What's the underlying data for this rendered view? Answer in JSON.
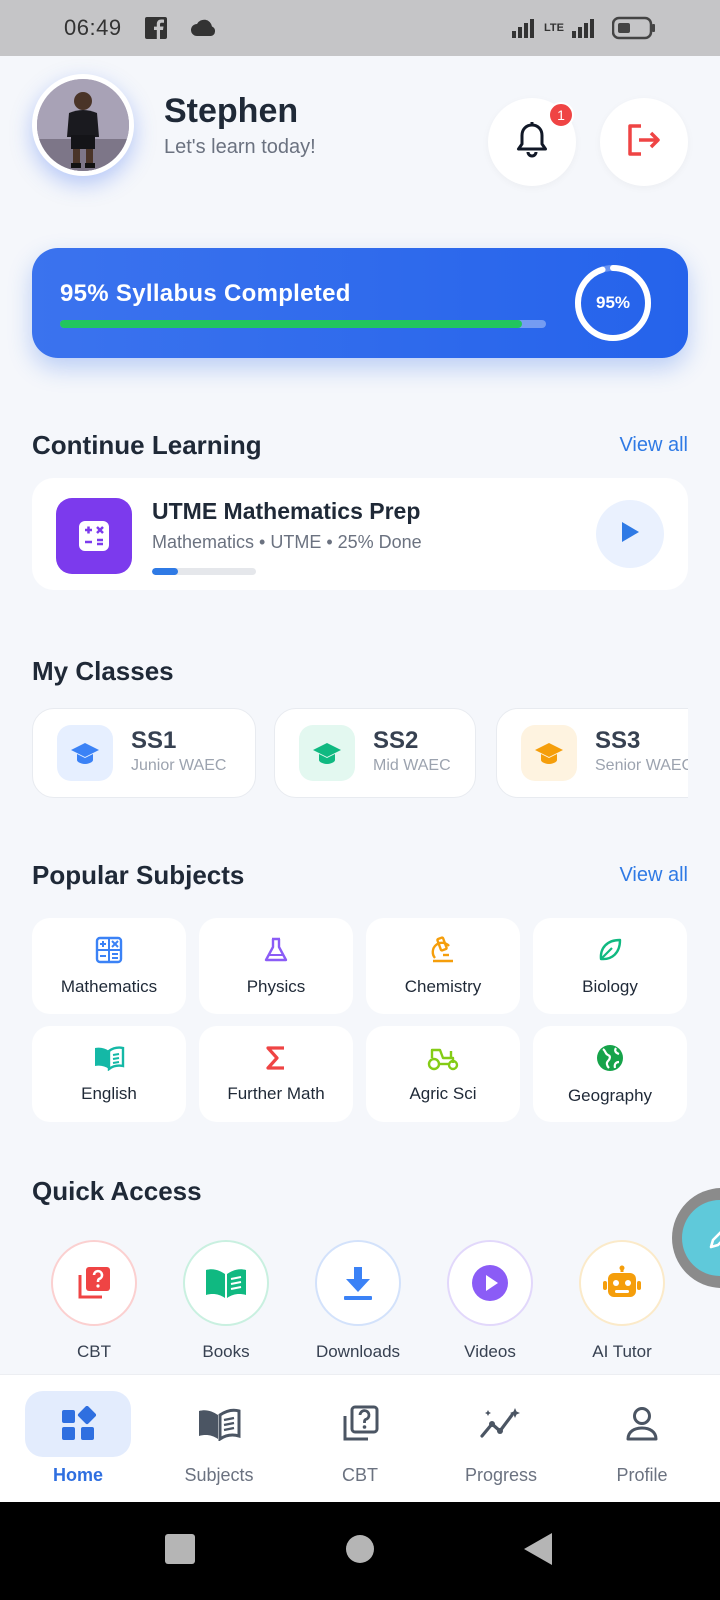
{
  "status_bar": {
    "time": "06:49",
    "network": "LTE"
  },
  "header": {
    "name": "Stephen",
    "subtitle": "Let's learn today!",
    "notification_count": "1"
  },
  "progress": {
    "title": "95% Syllabus Completed",
    "ring_label": "95%",
    "fraction": 0.95
  },
  "continue_learning": {
    "title": "Continue Learning",
    "view_all": "View all",
    "course": {
      "title": "UTME Mathematics Prep",
      "meta": "Mathematics • UTME • 25% Done",
      "fraction": 0.25
    }
  },
  "classes": {
    "title": "My Classes",
    "items": [
      {
        "name": "SS1",
        "sub": "Junior WAEC",
        "color": "#3b82f6",
        "bg": "#e6efff"
      },
      {
        "name": "SS2",
        "sub": "Mid WAEC",
        "color": "#10b981",
        "bg": "#e3f8f0"
      },
      {
        "name": "SS3",
        "sub": "Senior WAEC",
        "color": "#f59e0b",
        "bg": "#fef3e0"
      }
    ]
  },
  "subjects": {
    "title": "Popular Subjects",
    "view_all": "View all",
    "items": [
      {
        "label": "Mathematics",
        "icon": "calculator-icon",
        "color": "#3b82f6"
      },
      {
        "label": "Physics",
        "icon": "flask-icon",
        "color": "#8b5cf6"
      },
      {
        "label": "Chemistry",
        "icon": "microscope-icon",
        "color": "#f59e0b"
      },
      {
        "label": "Biology",
        "icon": "leaf-icon",
        "color": "#10b981"
      },
      {
        "label": "English",
        "icon": "book-open-icon",
        "color": "#14b8a6"
      },
      {
        "label": "Further Math",
        "icon": "sigma-icon",
        "color": "#ef4444"
      },
      {
        "label": "Agric Sci",
        "icon": "tractor-icon",
        "color": "#84cc16"
      },
      {
        "label": "Geography",
        "icon": "globe-icon",
        "color": "#16a34a"
      }
    ]
  },
  "quick_access": {
    "title": "Quick Access",
    "items": [
      {
        "label": "CBT",
        "icon": "quiz-icon",
        "color": "#ef4444",
        "ring": "#fbd0d0"
      },
      {
        "label": "Books",
        "icon": "book-open-icon",
        "color": "#10b981",
        "ring": "#c9f0e0"
      },
      {
        "label": "Downloads",
        "icon": "download-icon",
        "color": "#3b82f6",
        "ring": "#d3e2fb"
      },
      {
        "label": "Videos",
        "icon": "play-circle-icon",
        "color": "#8b5cf6",
        "ring": "#e2d8fb"
      },
      {
        "label": "AI Tutor",
        "icon": "robot-icon",
        "color": "#f59e0b",
        "ring": "#fbeac9"
      }
    ]
  },
  "bottom_nav": {
    "items": [
      {
        "label": "Home",
        "icon": "home-grid-icon",
        "active": true
      },
      {
        "label": "Subjects",
        "icon": "book-icon",
        "active": false
      },
      {
        "label": "CBT",
        "icon": "quiz-icon",
        "active": false
      },
      {
        "label": "Progress",
        "icon": "chart-line-icon",
        "active": false
      },
      {
        "label": "Profile",
        "icon": "user-icon",
        "active": false
      }
    ]
  },
  "colors": {
    "primary": "#2563eb",
    "progress_green": "#22c55e",
    "badge_red": "#ef4444"
  }
}
